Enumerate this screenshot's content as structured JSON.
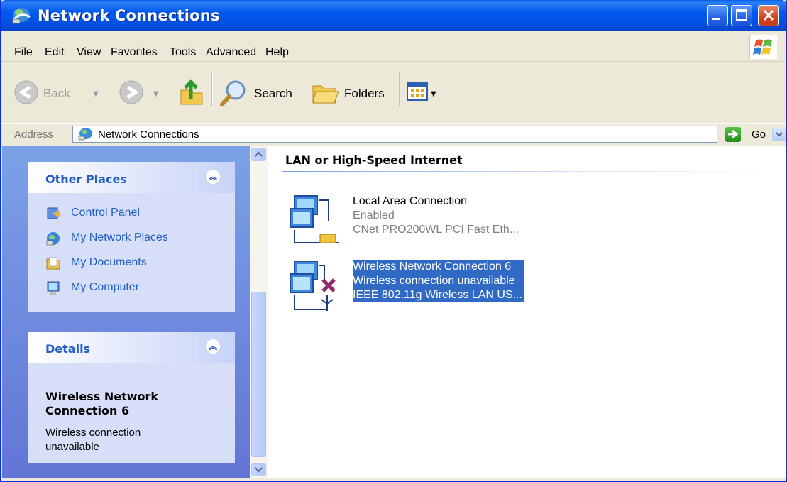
{
  "window": {
    "title": "Network Connections"
  },
  "menu": [
    "File",
    "Edit",
    "View",
    "Favorites",
    "Tools",
    "Advanced",
    "Help"
  ],
  "toolbar": {
    "back": "Back",
    "search": "Search",
    "folders": "Folders"
  },
  "address": {
    "label": "Address",
    "value": "Network Connections",
    "go": "Go"
  },
  "other_places": {
    "title": "Other Places",
    "items": [
      {
        "label": "Control Panel",
        "icon": "control-panel-icon"
      },
      {
        "label": "My Network Places",
        "icon": "network-places-icon"
      },
      {
        "label": "My Documents",
        "icon": "my-documents-icon"
      },
      {
        "label": "My Computer",
        "icon": "my-computer-icon"
      }
    ]
  },
  "details": {
    "title": "Details",
    "name": "Wireless Network Connection 6",
    "status": "Wireless connection unavailable"
  },
  "group": {
    "title": "LAN or High-Speed Internet"
  },
  "connections": [
    {
      "name": "Local Area Connection",
      "status": "Enabled",
      "device": "CNet PRO200WL PCI Fast Eth...",
      "selected": false
    },
    {
      "name": "Wireless Network Connection 6",
      "status": "Wireless connection unavailable",
      "device": "IEEE 802.11g Wireless LAN US...",
      "selected": true
    }
  ],
  "colors": {
    "titlebar": "#0058ee",
    "panel_text": "#215dc6",
    "selection": "#316ac5",
    "taskpane": "#6f8fdf"
  }
}
